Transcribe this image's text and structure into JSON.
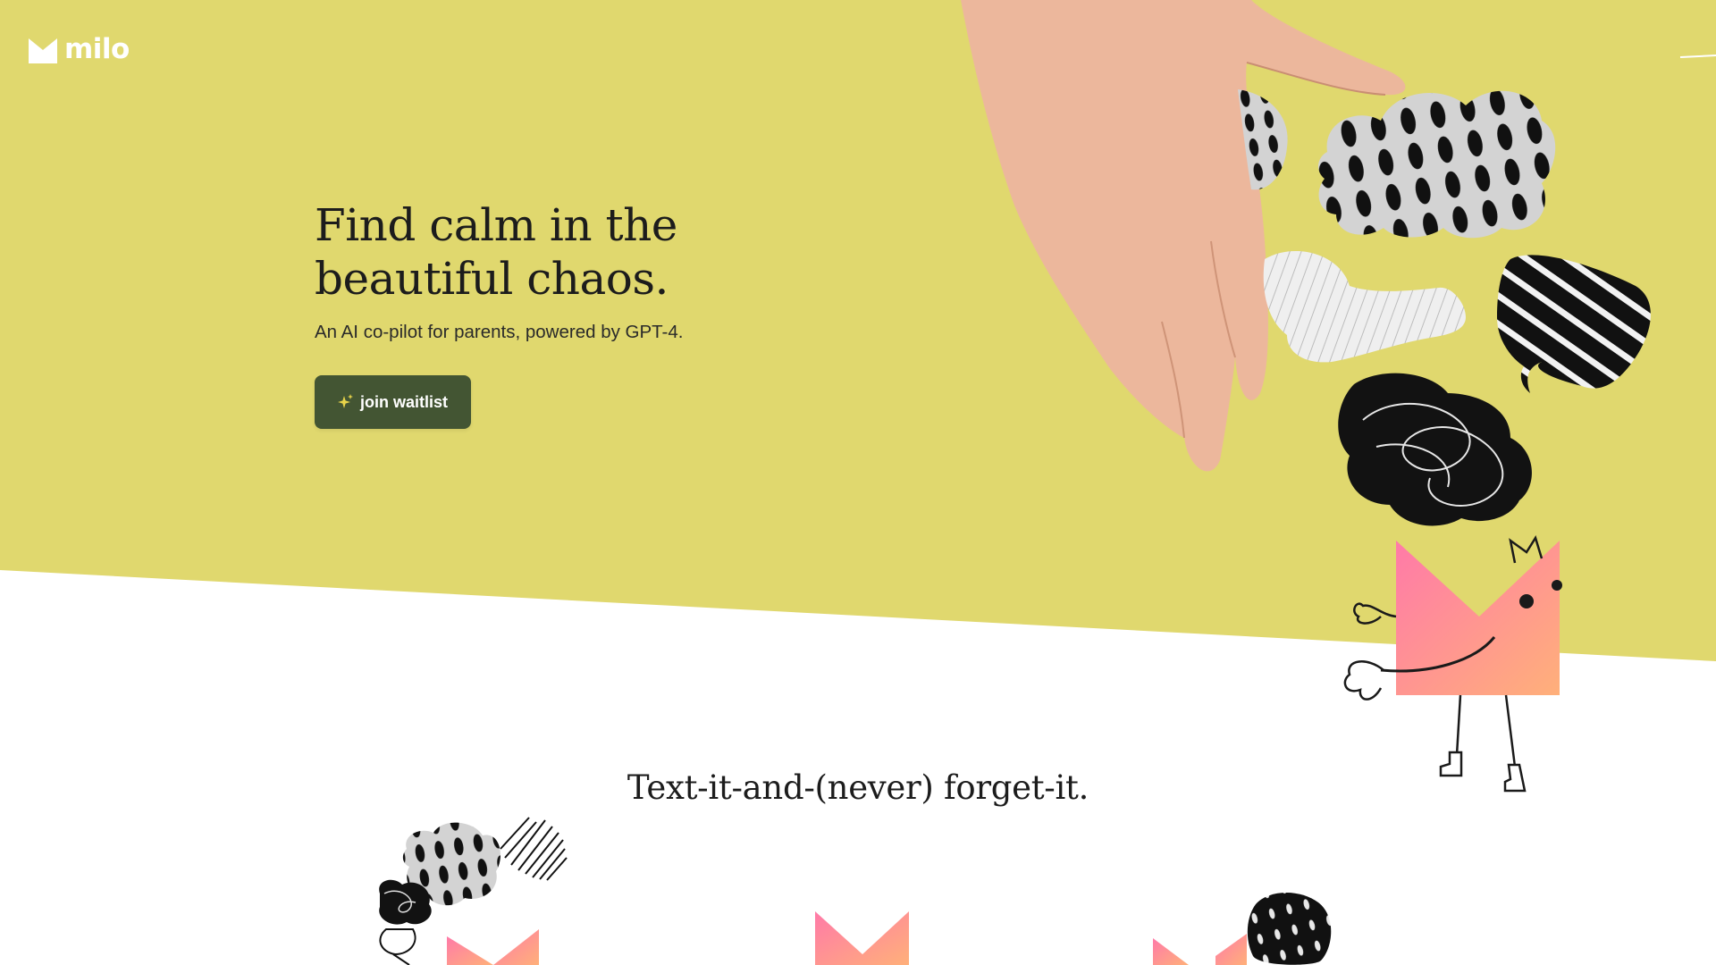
{
  "brand": {
    "name": "milo",
    "logo_icon": "m-logo-icon"
  },
  "hero": {
    "headline_line1": "Find calm in the",
    "headline_line2": "beautiful chaos.",
    "subheadline": "An AI co-pilot for parents, powered by GPT-4.",
    "cta_label": "join waitlist",
    "cta_icon": "sparkle-icon"
  },
  "section": {
    "title": "Text-it-and-(never) forget-it."
  },
  "colors": {
    "hero_background": "#e0d86e",
    "page_background": "#ffffff",
    "cta_background": "#435533",
    "cta_text": "#ffffff",
    "sparkle": "#e8d44a",
    "mascot_gradient_start": "#ff7aa8",
    "mascot_gradient_end": "#ffb07a",
    "text_primary": "#1c1c1c"
  },
  "illustrations": [
    "reaching-hand-image",
    "spotted-cloud-blob",
    "striped-scribble-blob",
    "zebra-speech-bubble",
    "black-scribble-blob",
    "pink-mascot-character",
    "feature-illustration-1",
    "feature-illustration-2",
    "feature-illustration-3"
  ]
}
